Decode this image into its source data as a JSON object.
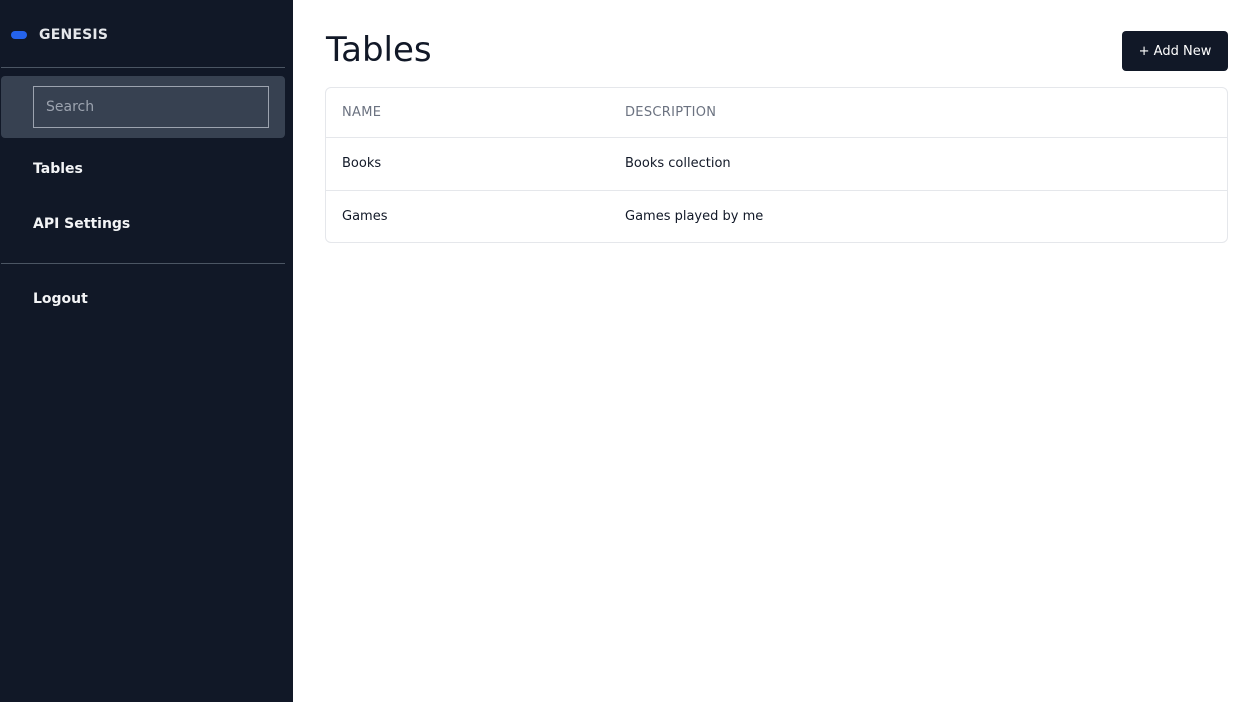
{
  "app": {
    "name": "GENESIS",
    "accent": "#2563eb",
    "sidebar_bg": "#111827"
  },
  "search": {
    "placeholder": "Search",
    "value": ""
  },
  "nav": {
    "tables_label": "Tables",
    "api_settings_label": "API Settings",
    "logout_label": "Logout"
  },
  "page": {
    "title": "Tables",
    "add_button_label": "+ Add New"
  },
  "table": {
    "columns": [
      "NAME",
      "DESCRIPTION"
    ],
    "rows": [
      {
        "name": "Books",
        "description": "Books collection"
      },
      {
        "name": "Games",
        "description": "Games played by me"
      }
    ]
  }
}
